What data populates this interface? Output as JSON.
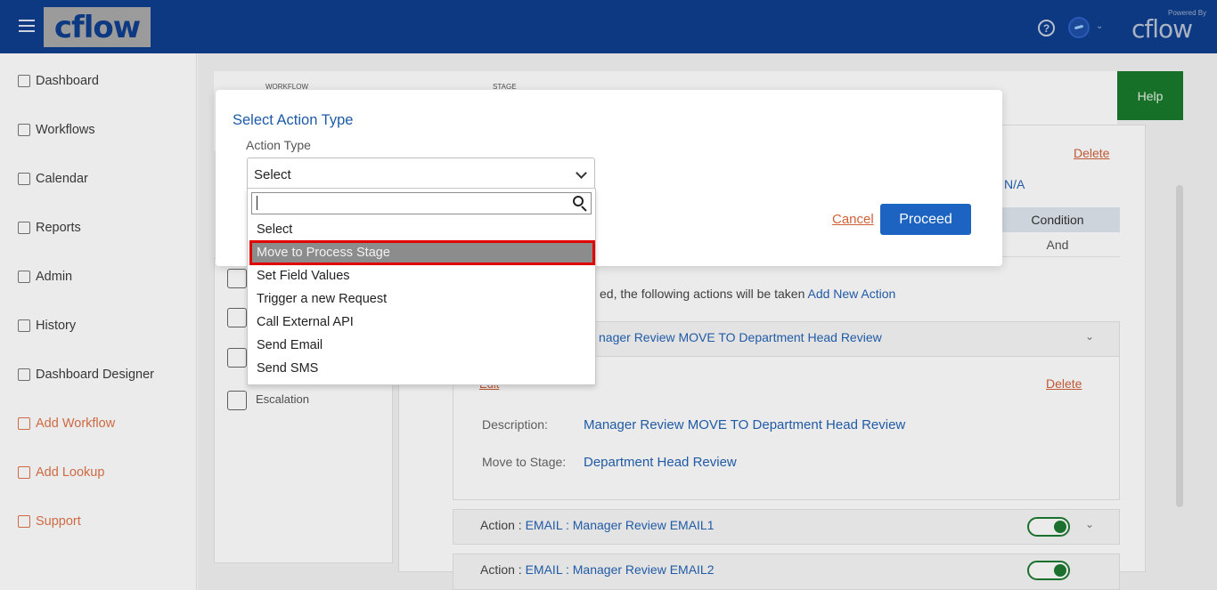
{
  "header": {
    "logo": "cflow",
    "help_glyph": "?",
    "caret": "⌄",
    "powered_by": "Powered By",
    "powered_logo": "cflow"
  },
  "sidebar": {
    "items": [
      {
        "label": "Dashboard",
        "icon": "home-icon"
      },
      {
        "label": "Workflows",
        "icon": "grid-icon"
      },
      {
        "label": "Calendar",
        "icon": "calendar-icon"
      },
      {
        "label": "Reports",
        "icon": "report-icon"
      },
      {
        "label": "Admin",
        "icon": "admin-icon"
      },
      {
        "label": "History",
        "icon": "history-icon"
      },
      {
        "label": "Dashboard Designer",
        "icon": "dashboard-designer-icon"
      },
      {
        "label": "Add Workflow",
        "icon": "add-workflow-icon"
      },
      {
        "label": "Add Lookup",
        "icon": "add-lookup-icon"
      },
      {
        "label": "Support",
        "icon": "headset-icon"
      }
    ]
  },
  "page": {
    "workflow_label": "WORKFLOW",
    "stage_label": "STAGE",
    "help": "Help",
    "delete": "Delete",
    "na": "N/A",
    "condition_header": "Condition",
    "condition_value": "And",
    "actions_line": "ed, the following actions will be taken",
    "add_new_action": "Add New Action",
    "escalation": "Escalation",
    "action1_title": "nager Review MOVE TO Department Head Review",
    "edit": "Edit",
    "description_label": "Description:",
    "description_value": "Manager Review MOVE TO Department Head Review",
    "move_label": "Move to Stage:",
    "move_value": "Department Head Review",
    "action2_prefix": "Action :",
    "action2_title": "EMAIL : Manager Review EMAIL1",
    "action3_prefix": "Action :",
    "action3_title": "EMAIL : Manager Review EMAIL2"
  },
  "modal": {
    "title": "Select Action Type",
    "field_label": "Action Type",
    "selected": "Select",
    "search_value": "",
    "options": [
      "Select",
      "Move to Process Stage",
      "Set Field Values",
      "Trigger a new Request",
      "Call External API",
      "Send Email",
      "Send SMS"
    ],
    "highlighted_index": 1,
    "cancel": "Cancel",
    "proceed": "Proceed"
  },
  "colors": {
    "header": "#0e3e8c",
    "accent": "#1d63c2",
    "link_orange": "#d0613a",
    "help_green": "#1a7a2b",
    "highlight_border": "#e00000"
  }
}
